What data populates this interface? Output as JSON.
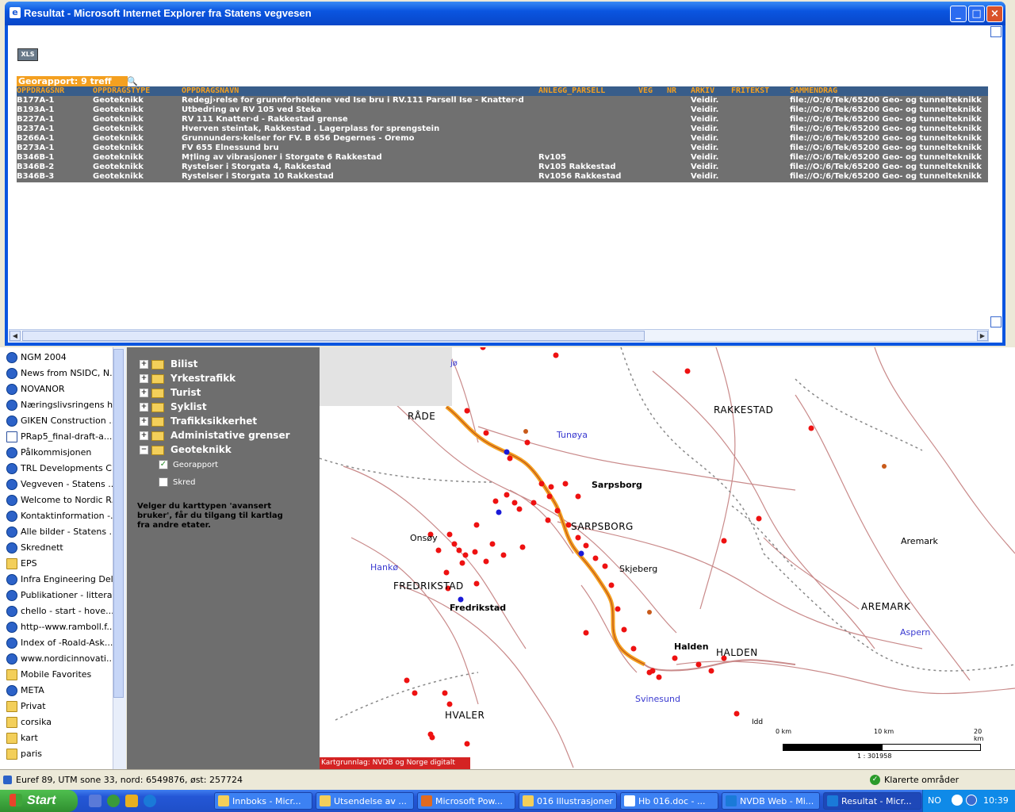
{
  "popup": {
    "title": "Resultat - Microsoft Internet Explorer fra Statens vegvesen",
    "xls_label": "XLS",
    "report_title": "Georapport: 9 treff",
    "columns": [
      "OPPDRAGSNR",
      "OPPDRAGSTYPE",
      "OPPDRAGSNAVN",
      "ANLEGG_PARSELL",
      "VEG",
      "NR",
      "ARKIV",
      "FRITEKST",
      "SAMMENDRAG"
    ],
    "rows": [
      {
        "nr": "B177A-1",
        "type": "Geoteknikk",
        "navn": "Redegj›relse for grunnforholdene ved Ise bru i RV.111 Parsell Ise - Knatter›d",
        "anlegg": "",
        "arkiv": "Veidir.",
        "sammendrag": "file://O:/6/Tek/65200 Geo- og tunnelteknikk"
      },
      {
        "nr": "B193A-1",
        "type": "Geoteknikk",
        "navn": "Utbedring av RV 105 ved Steka",
        "anlegg": "",
        "arkiv": "Veidir.",
        "sammendrag": "file://O:/6/Tek/65200 Geo- og tunnelteknikk"
      },
      {
        "nr": "B227A-1",
        "type": "Geoteknikk",
        "navn": "RV 111 Knatter›d - Rakkestad grense",
        "anlegg": "",
        "arkiv": "Veidir.",
        "sammendrag": "file://O:/6/Tek/65200 Geo- og tunnelteknikk"
      },
      {
        "nr": "B237A-1",
        "type": "Geoteknikk",
        "navn": "Hverven steintak, Rakkestad . Lagerplass for sprengstein",
        "anlegg": "",
        "arkiv": "Veidir.",
        "sammendrag": "file://O:/6/Tek/65200 Geo- og tunnelteknikk"
      },
      {
        "nr": "B266A-1",
        "type": "Geoteknikk",
        "navn": "Grunnunders›kelser for FV. B 656 Degernes - Oremo",
        "anlegg": "",
        "arkiv": "Veidir.",
        "sammendrag": "file://O:/6/Tek/65200 Geo- og tunnelteknikk"
      },
      {
        "nr": "B273A-1",
        "type": "Geoteknikk",
        "navn": "FV 655 Elnessund bru",
        "anlegg": "",
        "arkiv": "Veidir.",
        "sammendrag": "file://O:/6/Tek/65200 Geo- og tunnelteknikk"
      },
      {
        "nr": "B346B-1",
        "type": "Geoteknikk",
        "navn": "M†ling av vibrasjoner i Storgate 6 Rakkestad",
        "anlegg": "Rv105",
        "arkiv": "Veidir.",
        "sammendrag": "file://O:/6/Tek/65200 Geo- og tunnelteknikk"
      },
      {
        "nr": "B346B-2",
        "type": "Geoteknikk",
        "navn": "Rystelser i Storgata 4, Rakkestad",
        "anlegg": "Rv105 Rakkestad",
        "arkiv": "Veidir.",
        "sammendrag": "file://O:/6/Tek/65200 Geo- og tunnelteknikk"
      },
      {
        "nr": "B346B-3",
        "type": "Geoteknikk",
        "navn": "Rystelser i Storgata 10 Rakkestad",
        "anlegg": "Rv1056 Rakkestad",
        "arkiv": "Veidir.",
        "sammendrag": "file://O:/6/Tek/65200 Geo- og tunnelteknikk"
      }
    ]
  },
  "favorites": [
    {
      "label": "NGM 2004",
      "icon": "ie"
    },
    {
      "label": "News from NSIDC, N...",
      "icon": "ie"
    },
    {
      "label": "NOVANOR",
      "icon": "ie"
    },
    {
      "label": "Næringslivsringens h...",
      "icon": "ie"
    },
    {
      "label": "GIKEN Construction ...",
      "icon": "ie"
    },
    {
      "label": "PRap5_final-draft-a...",
      "icon": "doc"
    },
    {
      "label": "Pålkommisjonen",
      "icon": "ie"
    },
    {
      "label": "TRL Developments C...",
      "icon": "ie"
    },
    {
      "label": "Vegveven - Statens ...",
      "icon": "ie"
    },
    {
      "label": "Welcome to Nordic R...",
      "icon": "ie"
    },
    {
      "label": "Kontaktinformation -...",
      "icon": "ie"
    },
    {
      "label": "Alle bilder - Statens ...",
      "icon": "ie"
    },
    {
      "label": "Skrednett",
      "icon": "ie"
    },
    {
      "label": "EPS",
      "icon": "folder"
    },
    {
      "label": "Infra Engineering Delft",
      "icon": "ie"
    },
    {
      "label": "Publikationer - littera...",
      "icon": "ie"
    },
    {
      "label": "chello - start - hove...",
      "icon": "ie"
    },
    {
      "label": "http--www.ramboll.f...",
      "icon": "ie"
    },
    {
      "label": "Index of -Roald-Ask...",
      "icon": "ie"
    },
    {
      "label": "www.nordicinnovati...",
      "icon": "ie"
    },
    {
      "label": "Mobile Favorites",
      "icon": "folder"
    },
    {
      "label": "META",
      "icon": "ie"
    },
    {
      "label": "Privat",
      "icon": "folder"
    },
    {
      "label": "corsika",
      "icon": "folder"
    },
    {
      "label": "kart",
      "icon": "folder"
    },
    {
      "label": "paris",
      "icon": "folder"
    }
  ],
  "layers": {
    "groups": [
      "Bilist",
      "Yrkestrafikk",
      "Turist",
      "Syklist",
      "Trafikksikkerhet",
      "Administative grenser",
      "Geoteknikk"
    ],
    "sub": [
      {
        "label": "Georapport",
        "checked": "✓"
      },
      {
        "label": "Skred",
        "checked": ""
      }
    ],
    "note": "Velger du karttypen 'avansert bruker', får du tilgang til kartlag fra andre etater."
  },
  "map": {
    "places": {
      "rade": "RÅDE",
      "rakkestad": "RAKKESTAD",
      "tunoya": "Tunøya",
      "sarpsborg_town": "Sarpsborg",
      "sarpsborg": "SARPSBORG",
      "onsoy": "Onsøy",
      "hanko": "Hankø",
      "fredrikstad": "FREDRIKSTAD",
      "fredrikstad_town": "Fredrikstad",
      "skjeberg": "Skjeberg",
      "aremark_town": "Aremark",
      "aremark": "AREMARK",
      "aspern": "Aspern",
      "halden_town": "Halden",
      "halden": "HALDEN",
      "svinesund": "Svinesund",
      "hvaler": "HVALER",
      "idd": "Idd",
      "jo": "jø"
    },
    "scale": {
      "s0": "0 km",
      "s10": "10 km",
      "s20": "20 km",
      "ratio": "1 : 301958"
    },
    "credit": "Kartgrunnlag: NVDB og Norge digitalt"
  },
  "status": {
    "coords": "Euref 89, UTM sone 33, nord: 6549876, øst: 257724",
    "zone": "Klarerte områder"
  },
  "taskbar": {
    "start": "Start",
    "tasks": [
      "Innboks - Micr...",
      "Utsendelse av ...",
      "Microsoft Pow...",
      "016 Illustrasjoner",
      "Hb 016.doc - ...",
      "NVDB Web - Mi...",
      "Resultat - Micr..."
    ],
    "lang": "NO",
    "clock": "10:39"
  },
  "colors": {
    "report_orange": "#f4a020",
    "table_gray": "#707070",
    "panel_gray": "#6e6e6e",
    "road_orange": "#f4a020",
    "marker_red": "#ee1111"
  }
}
